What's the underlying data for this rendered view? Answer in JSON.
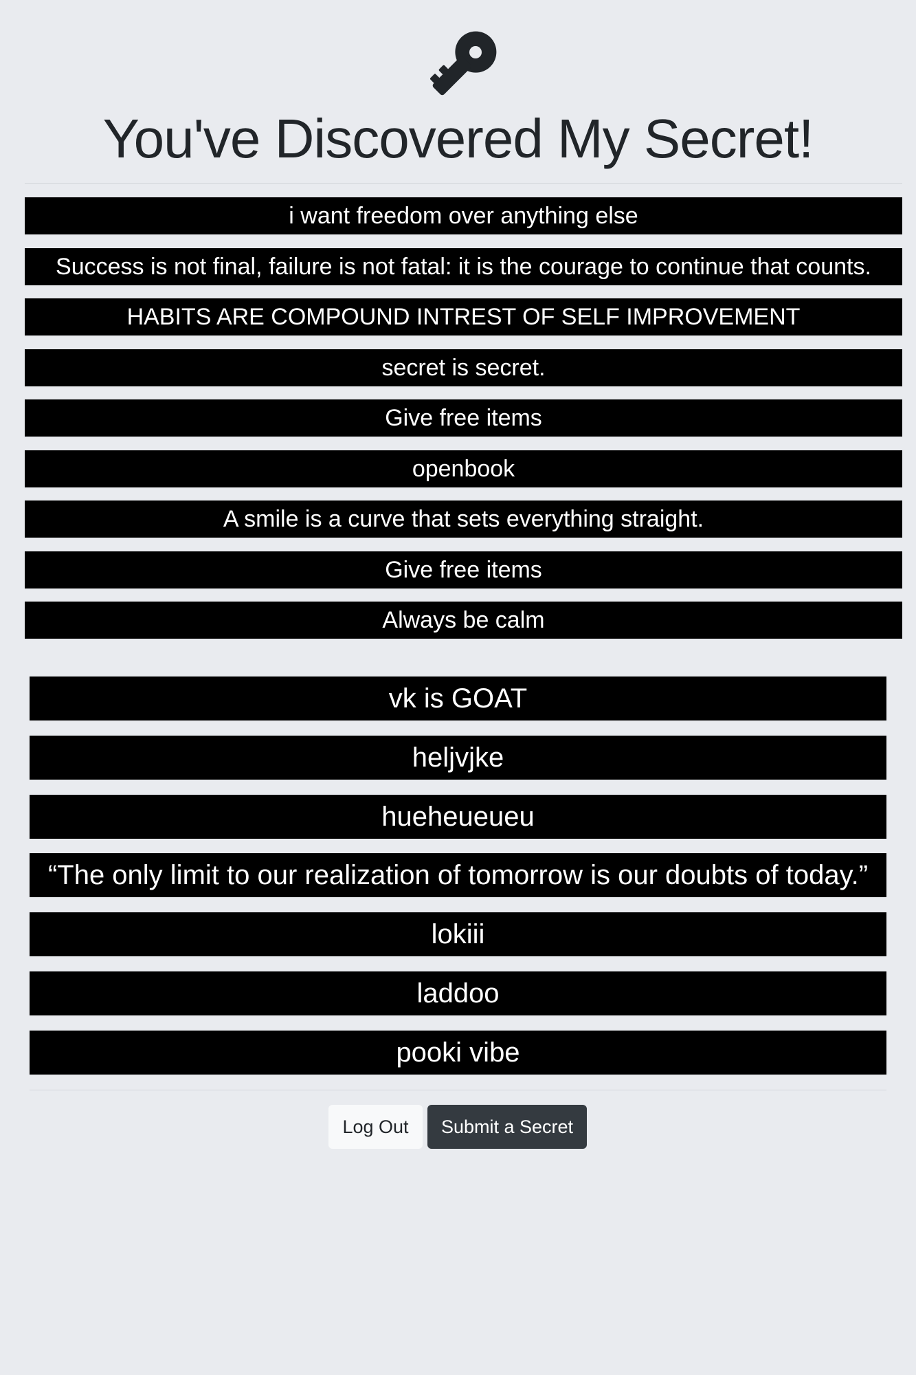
{
  "header": {
    "icon": "key-icon",
    "title": "You've Discovered My Secret!"
  },
  "secrets_primary": [
    "i want freedom over anything else",
    "Success is not final, failure is not fatal: it is the courage to continue that counts.",
    "HABITS ARE COMPOUND INTREST OF SELF IMPROVEMENT",
    "secret is secret.",
    "Give free items",
    "openbook",
    "A smile is a curve that sets everything straight.",
    "Give free items",
    "Always be calm"
  ],
  "secrets_secondary": [
    "vk is GOAT",
    "heljvjke",
    "hueheueueu",
    "“The only limit to our realization of tomorrow is our doubts of today.”",
    "lokiii",
    "laddoo",
    "pooki vibe"
  ],
  "actions": {
    "logout_label": "Log Out",
    "submit_label": "Submit a Secret"
  },
  "colors": {
    "background": "#e9ebef",
    "secret_bg": "#000000",
    "secret_text": "#ffffff",
    "title": "#212529",
    "btn_light": "#f8f9fa",
    "btn_dark": "#343a40"
  }
}
